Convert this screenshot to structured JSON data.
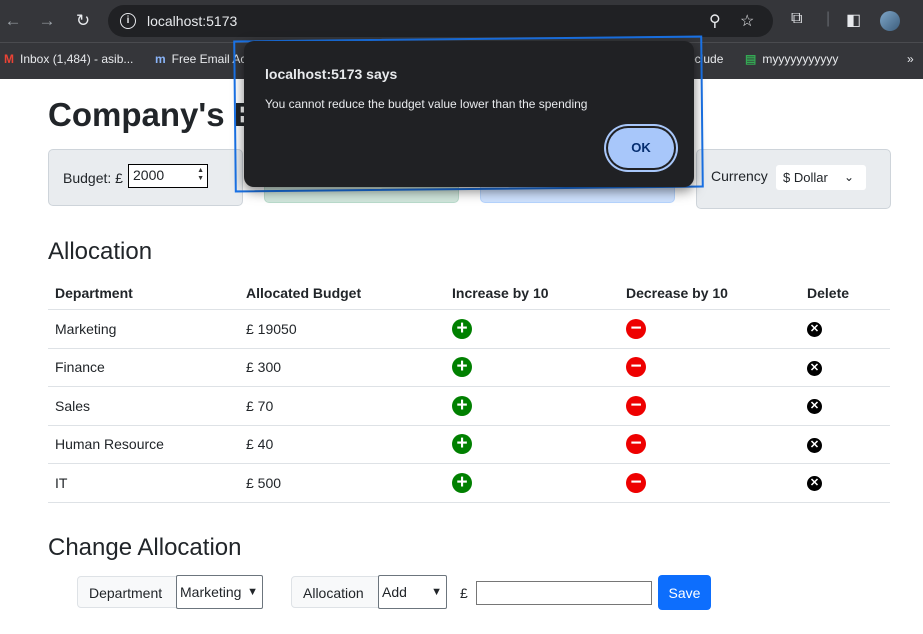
{
  "browser": {
    "url": "localhost:5173",
    "bookmarks": [
      {
        "label": "Inbox (1,484) - asib...",
        "icon": "gmail-icon"
      },
      {
        "label": "Free Email Ac",
        "icon": "mailchimp-icon"
      },
      {
        "label": "eclude",
        "icon": "bookmark-icon"
      },
      {
        "label": "myyyyyyyyyyy",
        "icon": "sheets-icon"
      }
    ]
  },
  "page": {
    "title": "Company's B",
    "budget": {
      "label": "Budget: £",
      "value": "2000"
    },
    "currency": {
      "label": "Currency",
      "selected": "$ Dollar"
    }
  },
  "allocation": {
    "title": "Allocation",
    "headers": [
      "Department",
      "Allocated Budget",
      "Increase by 10",
      "Decrease by 10",
      "Delete"
    ],
    "rows": [
      {
        "department": "Marketing",
        "budget": "£ 19050"
      },
      {
        "department": "Finance",
        "budget": "£ 300"
      },
      {
        "department": "Sales",
        "budget": "£ 70"
      },
      {
        "department": "Human Resource",
        "budget": "£ 40"
      },
      {
        "department": "IT",
        "budget": "£ 500"
      }
    ]
  },
  "change": {
    "title": "Change Allocation",
    "department_label": "Department",
    "department_value": "Marketing",
    "allocation_label": "Allocation",
    "allocation_value": "Add",
    "currency_symbol": "£",
    "save_label": "Save"
  },
  "alert": {
    "title": "localhost:5173 says",
    "message": "You cannot reduce the budget value lower than the spending",
    "ok_label": "OK"
  },
  "colors": {
    "increase": "#008000",
    "decrease": "#ee0000",
    "primary": "#0d6efd"
  }
}
